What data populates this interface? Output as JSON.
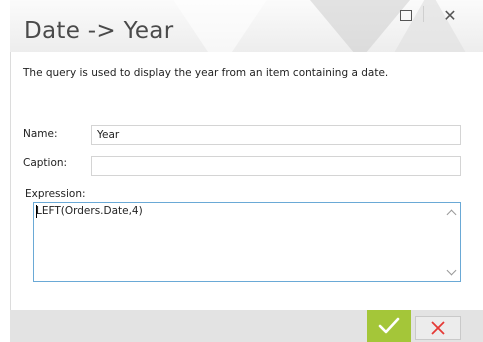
{
  "window": {
    "title": "Date -> Year",
    "maximize_icon": "maximize-icon",
    "close_icon": "close-icon"
  },
  "description": "The query is used to display the year from an item containing a date.",
  "form": {
    "name_label": "Name:",
    "name_value": "Year",
    "caption_label": "Caption:",
    "caption_value": "",
    "expression_label": "Expression:",
    "expression_value": "LEFT(Orders.Date,4)"
  },
  "footer": {
    "ok_icon": "check-icon",
    "cancel_icon": "cross-icon"
  },
  "colors": {
    "accent_green": "#a4c639",
    "cancel_red": "#e53935",
    "focus_border": "#6aa9d6"
  }
}
